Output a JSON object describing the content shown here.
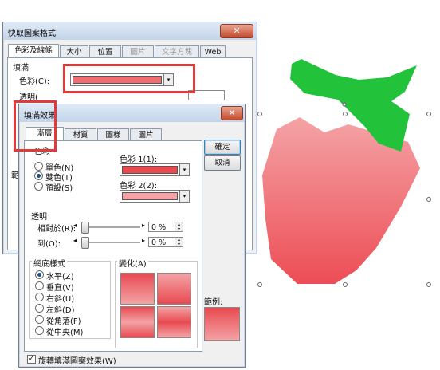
{
  "back_dialog": {
    "title": "快取圖案格式",
    "close_glyph": "✕",
    "tabs": [
      {
        "label": "色彩及線條"
      },
      {
        "label": "大小"
      },
      {
        "label": "位置"
      },
      {
        "label": "圖片"
      },
      {
        "label": "文字方塊"
      },
      {
        "label": "Web"
      }
    ],
    "fill_heading": "填滿",
    "color_label": "色彩(C):",
    "transparency_label": "透明(",
    "partial_label": "範",
    "fill_color": "#ee6e72"
  },
  "fill_effects": {
    "title": "填滿效果",
    "close_glyph": "✕",
    "tabs": [
      {
        "label": "漸層"
      },
      {
        "label": "材質"
      },
      {
        "label": "圖樣"
      },
      {
        "label": "圖片"
      }
    ],
    "colors_heading": "色彩",
    "radios": [
      {
        "label": "單色(N)",
        "selected": false
      },
      {
        "label": "雙色(T)",
        "selected": true
      },
      {
        "label": "預設(S)",
        "selected": false
      }
    ],
    "color1_label": "色彩 1(1):",
    "color2_label": "色彩 2(2):",
    "color1": "#e84a50",
    "color2": "#f3a3a6",
    "transparency_heading": "透明",
    "from_label": "相對於(R):",
    "to_label": "到(O):",
    "from_value": "0 %",
    "to_value": "0 %",
    "from_level": 0,
    "to_level": 0,
    "shading_heading": "網底樣式",
    "shading_styles": [
      {
        "label": "水平(Z)",
        "selected": true
      },
      {
        "label": "垂直(V)",
        "selected": false
      },
      {
        "label": "右斜(U)",
        "selected": false
      },
      {
        "label": "左斜(D)",
        "selected": false
      },
      {
        "label": "從角落(F)",
        "selected": false
      },
      {
        "label": "從中央(M)",
        "selected": false
      }
    ],
    "variants_heading": "變化(A)",
    "sample_label": "範例:",
    "ok_label": "確定",
    "cancel_label": "取消",
    "rotate_checkbox": "旋轉填滿圖案效果(W)",
    "rotate_checked": true,
    "arrow_left": "◂",
    "arrow_right": "▸",
    "dropdown_arrow": "▾",
    "check_glyph": "✓"
  },
  "canvas": {
    "leaf_color": "#22c23b",
    "body_top_color": "#f4a3a6",
    "body_bottom_color": "#ed4d55"
  },
  "highlight_color": "#e23a3a"
}
